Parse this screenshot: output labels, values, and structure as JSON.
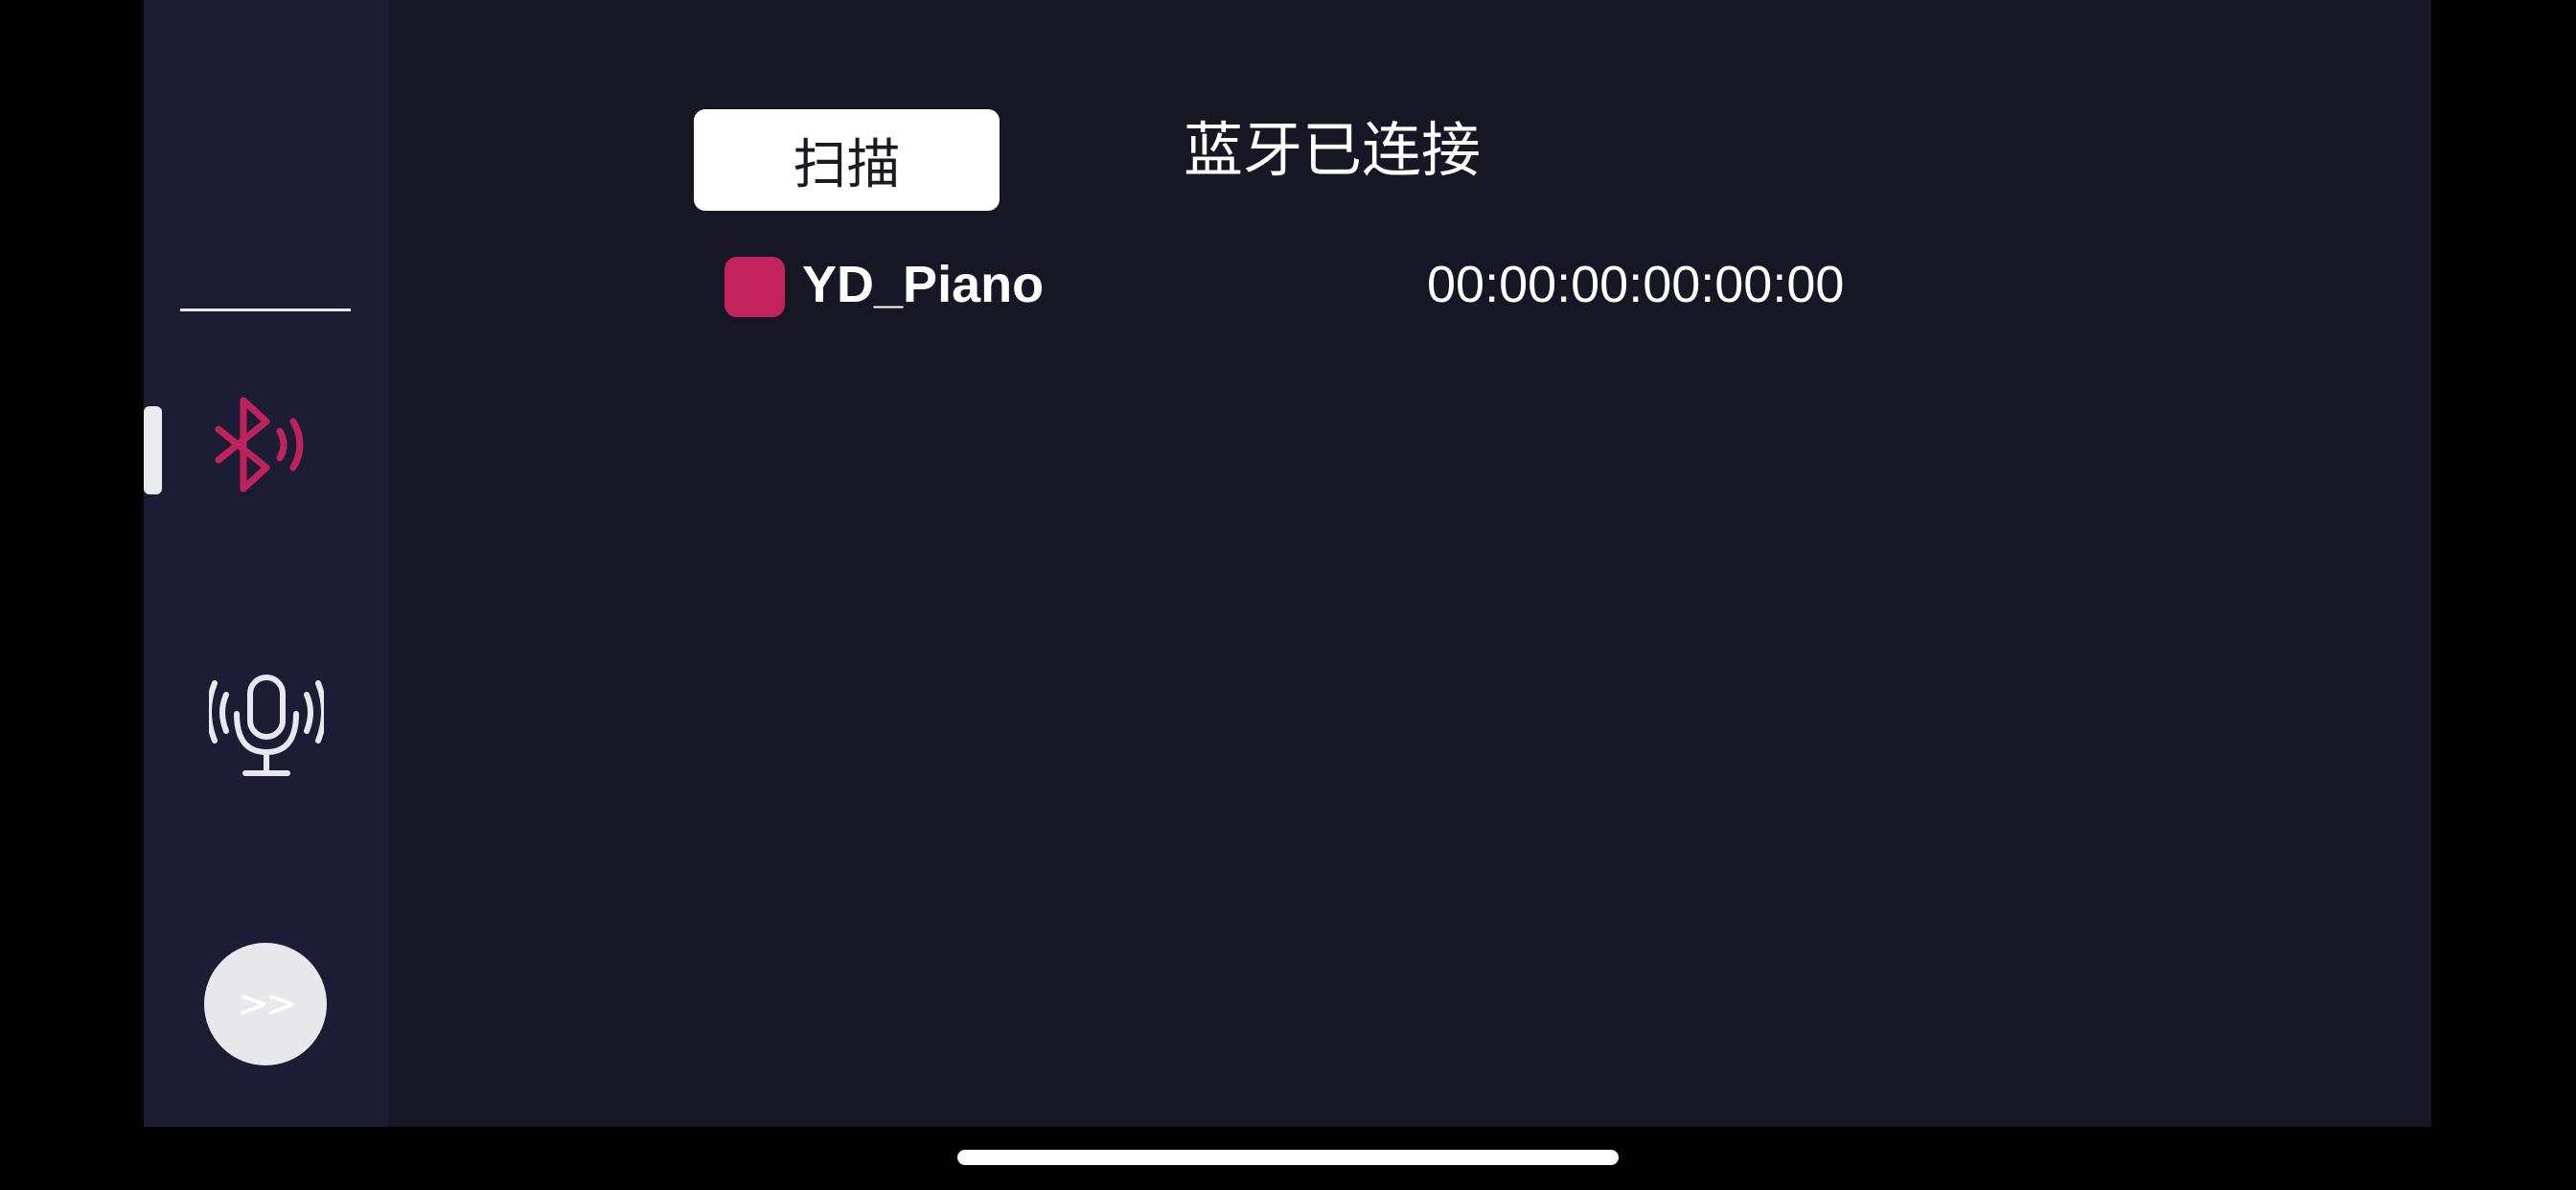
{
  "sidebar": {
    "items": [
      {
        "name": "bluetooth",
        "icon": "bluetooth-icon",
        "selected": true
      },
      {
        "name": "microphone",
        "icon": "microphone-icon",
        "selected": false
      }
    ],
    "forward_label": ">>"
  },
  "main": {
    "scan_label": "扫描",
    "status_text": "蓝牙已连接",
    "devices": [
      {
        "name": "YD_Piano",
        "address": "00:00:00:00:00:00",
        "color": "#c2225b"
      }
    ]
  },
  "colors": {
    "sidebar_bg": "#1c1d35",
    "main_bg": "#161625",
    "accent": "#c2225b",
    "icon_light": "#e8e8ee"
  }
}
